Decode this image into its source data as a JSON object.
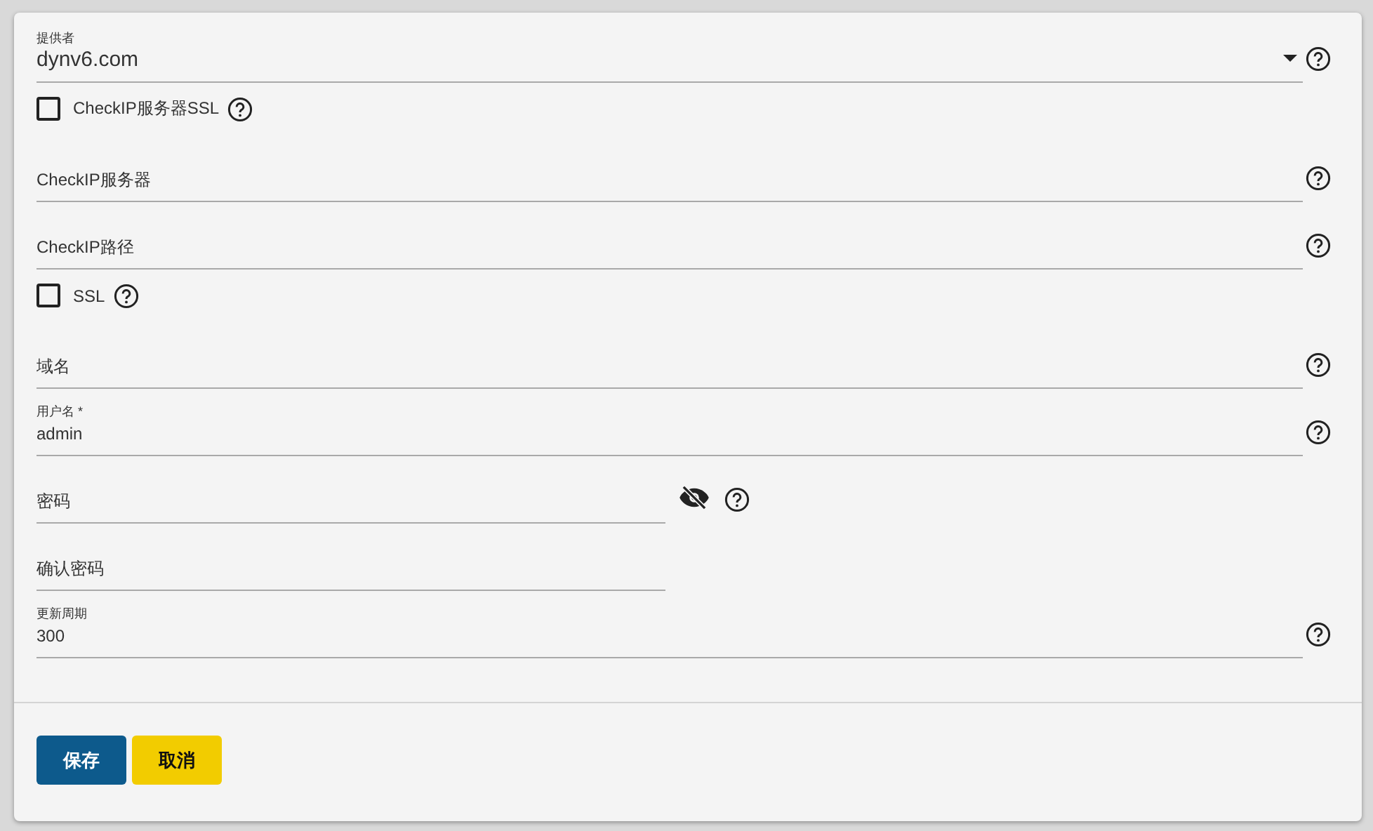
{
  "form": {
    "fields": [
      {
        "kind": "select",
        "label": "提供者",
        "value": "dynv6.com",
        "help": true
      },
      {
        "kind": "checkbox",
        "label": "CheckIP服务器SSL",
        "checked": false,
        "help": true
      },
      {
        "kind": "text",
        "label": "CheckIP服务器",
        "help": true
      },
      {
        "kind": "text",
        "label": "CheckIP路径",
        "help": true
      },
      {
        "kind": "checkbox",
        "label": "SSL",
        "checked": false,
        "help": true
      },
      {
        "kind": "text",
        "label": "域名",
        "help": true
      },
      {
        "kind": "text",
        "label": "用户名 *",
        "value": "admin",
        "help": true
      },
      {
        "kind": "password",
        "label": "密码",
        "help": true,
        "visibility_toggle": true,
        "revealed": false
      },
      {
        "kind": "password",
        "label": "确认密码",
        "help": false,
        "visibility_toggle": false
      },
      {
        "kind": "text",
        "label": "更新周期",
        "value": "300",
        "help": true
      }
    ]
  },
  "buttons": [
    {
      "label": "保存",
      "kind": "primary"
    },
    {
      "label": "取消",
      "kind": "secondary"
    }
  ]
}
